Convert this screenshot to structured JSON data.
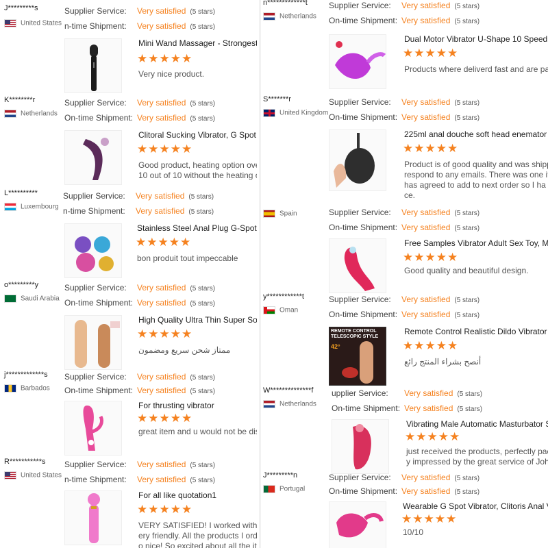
{
  "colors": {
    "accent": "#f58220",
    "text": "#222222",
    "muted": "#666666"
  },
  "labels": {
    "supplier": "Supplier Service:",
    "ontime_a": "On-time Shipment:",
    "ontime_b": "n-time Shipment:",
    "supplier_b": "upplier Service:",
    "very_satisfied": "Very satisfied",
    "five_stars": "(5 stars)",
    "stars": "★★★★★"
  },
  "left": [
    {
      "buyer": "J*********s",
      "country": "United States",
      "flag": "us",
      "title": "Mini Wand Massager - Strongest C",
      "comment": [
        "Very nice product."
      ]
    },
    {
      "buyer": "K********r",
      "country": "Netherlands",
      "flag": "nl",
      "title": "Clitoral Sucking Vibrator, G Spot S",
      "comment": [
        "Good product, heating option over",
        "10 out of 10 without the heating op"
      ]
    },
    {
      "buyer": "L**********",
      "country": "Luxembourg",
      "flag": "lu",
      "title": "Stainless Steel Anal Plug G-Spot W",
      "comment": [
        "bon produit tout impeccable"
      ]
    },
    {
      "buyer": "o*********y",
      "country": "Saudi Arabia",
      "flag": "sa",
      "title": "High Quality Ultra Thin Super Soft",
      "comment": [
        "ممتاز شحن سريع ومضمون"
      ]
    },
    {
      "buyer": "j*************s",
      "country": "Barbados",
      "flag": "bb",
      "title": "For thrusting vibrator",
      "comment": [
        "great item and u would not be disa"
      ]
    },
    {
      "buyer": "R***********s",
      "country": "United States",
      "flag": "us",
      "title": "For all like quotation1",
      "comment": [
        "VERY SATISFIED! I worked with Ma",
        "ery friendly. All the products I orde",
        "o nice! So excited about all the iter"
      ]
    }
  ],
  "right": [
    {
      "buyer": "n*************t",
      "country": "Netherlands",
      "flag": "nl",
      "title": "Dual Motor Vibrator U-Shape 10 Speed Re",
      "comment": [
        "Products where deliverd fast and are pack"
      ]
    },
    {
      "buyer": "S*******r",
      "country": "United Kingdom",
      "flag": "uk",
      "title": "225ml anal douche soft head enemator a",
      "comment": [
        "Product is of good quality and was shippe",
        "respond to any emails. There was one iter",
        "has agreed to add to next order so I ha",
        "ce."
      ]
    },
    {
      "buyer": "",
      "country": "Spain",
      "flag": "es",
      "title": "Free Samples Vibrator Adult Sex Toy, Med",
      "comment": [
        "Good quality and beautiful design."
      ]
    },
    {
      "buyer": "y************t",
      "country": "Oman",
      "flag": "om",
      "title": "Remote Control Realistic Dildo Vibrator fo",
      "comment": [
        "أنصح بشراء المنتج رائع"
      ],
      "thumb_text": [
        "REMOTE CONTROL",
        "TELESCOPIC STYLE",
        "42°"
      ]
    },
    {
      "buyer": "W**************f",
      "country": "Netherlands",
      "flag": "nl",
      "title": "Vibrating Male Automatic Masturbator S",
      "comment": [
        "just received the products, perfectly pack",
        "y impressed by the great service of John"
      ]
    },
    {
      "buyer": "J*********n",
      "country": "Portugal",
      "flag": "pt",
      "title": "Wearable G Spot Vibrator, Clitoris Anal Va",
      "comment": [
        "10/10"
      ]
    }
  ]
}
